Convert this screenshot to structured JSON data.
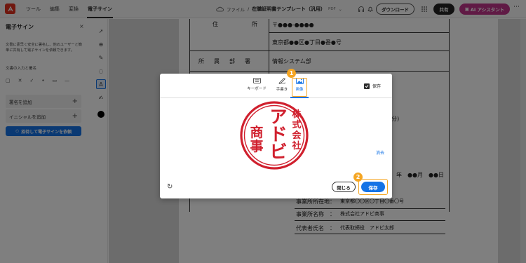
{
  "menu": {
    "items": [
      "ツール",
      "編集",
      "変換",
      "電子サイン"
    ],
    "active_index": 3
  },
  "file": {
    "breadcrumb": "ファイル",
    "separator": "/",
    "doc_name": "在職証明書テンプレート（汎用）",
    "format": "PDF"
  },
  "topbar": {
    "download": "ダウンロード",
    "share": "共有",
    "ai": "AI アシスタント",
    "more": "⋯"
  },
  "left_panel": {
    "title": "電子サイン",
    "close": "×",
    "description": "文書に素早く安全に署名し、他のユーザーと簡単に共有して電子サインを依頼できます。",
    "section_label": "文書の入力と署名",
    "add_signature": "署名を追加",
    "add_initials": "イニシャルを追加",
    "request_button": "招待して電子サインを依頼"
  },
  "document": {
    "rows": [
      {
        "label": "住　　　所",
        "value": "〒●●●-●●●●"
      },
      {
        "label": "",
        "value": "東京都●●区●丁目●番●号"
      },
      {
        "label": "所　属　部　署",
        "value": "情報システム部"
      }
    ],
    "partial_time": "分)",
    "date_line": "年　●●月　●●日",
    "address_label": "事業所所在地：",
    "address_value": "東京都〇〇区〇丁目〇番〇号",
    "company_label": "事業所名称　：",
    "company_value": "株式会社アドビ商事",
    "rep_label": "代表者氏名　：",
    "rep_value": "代表取締役　アドビ太郎"
  },
  "modal": {
    "tabs": [
      {
        "label": "キーボード",
        "icon": "keyboard-icon"
      },
      {
        "label": "手書き",
        "icon": "pen-icon"
      },
      {
        "label": "画像",
        "icon": "image-icon"
      }
    ],
    "active_tab": 2,
    "save_checkbox_label": "保存",
    "save_checked": true,
    "erase": "消去",
    "close_button": "閉じる",
    "save_button": "保存",
    "step1": "1",
    "step2": "2",
    "seal_text": "株式会社アドビ商事",
    "seal_color": "#d0202e"
  }
}
